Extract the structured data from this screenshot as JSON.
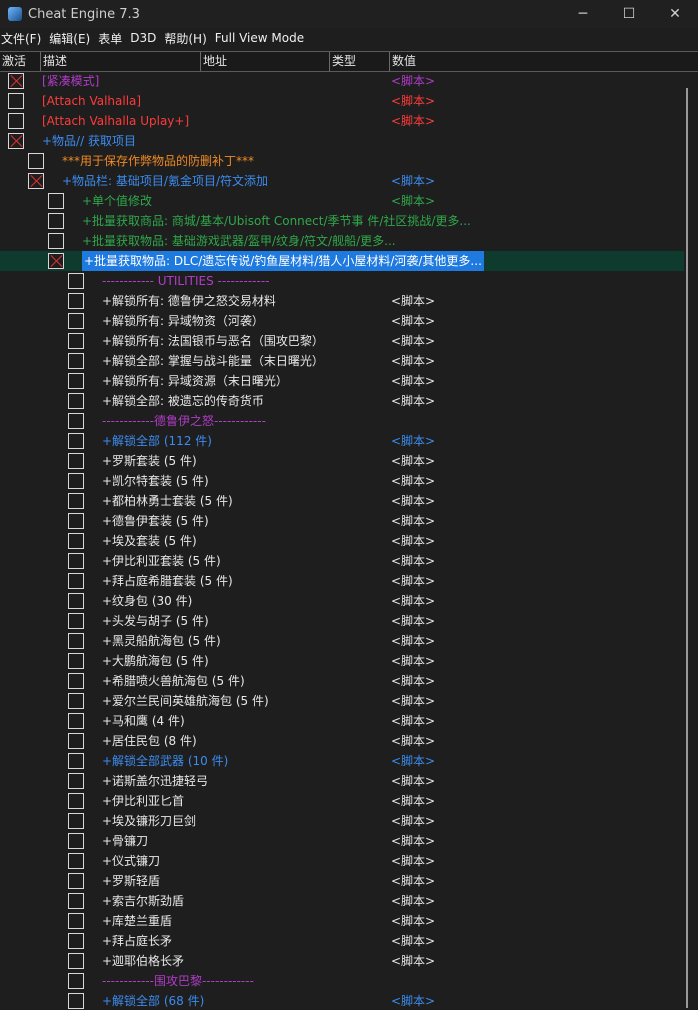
{
  "window": {
    "title": "Cheat Engine 7.3",
    "controls": {
      "minimize": "─",
      "maximize": "☐",
      "close": "✕"
    }
  },
  "menu": [
    "文件(F)",
    "编辑(E)",
    "表单",
    "D3D",
    "帮助(H)",
    "Full View Mode"
  ],
  "columns": [
    "激活",
    "描述",
    "地址",
    "类型",
    "数值"
  ],
  "colors": {
    "red": "#ff3b3b",
    "purple": "#b03cc8",
    "blue": "#3c8cf0",
    "orange": "#f08a24",
    "green": "#2fa84b",
    "white": "#e8e8e8",
    "script_white": "#e8e8e8"
  },
  "rows": [
    {
      "level": 0,
      "checked": true,
      "desc": "[紧凑模式]",
      "value": "<脚本>",
      "color": "#b03cc8",
      "vcolor": "#b03cc8"
    },
    {
      "level": 0,
      "checked": false,
      "desc": "[Attach Valhalla]",
      "value": "<脚本>",
      "color": "#ff3b3b",
      "vcolor": "#ff3b3b"
    },
    {
      "level": 0,
      "checked": false,
      "desc": "[Attach Valhalla Uplay+]",
      "value": "<脚本>",
      "color": "#ff3b3b",
      "vcolor": "#ff3b3b"
    },
    {
      "level": 0,
      "checked": true,
      "desc": "+物品// 获取项目",
      "value": "",
      "color": "#3c8cf0",
      "vcolor": "#3c8cf0"
    },
    {
      "level": 1,
      "checked": false,
      "desc": "***用于保存作弊物品的防删补丁***",
      "value": "",
      "color": "#f08a24",
      "vcolor": "#f08a24"
    },
    {
      "level": 1,
      "checked": true,
      "desc": "+物品栏: 基础项目/氪金项目/符文添加",
      "value": "<脚本>",
      "color": "#3c8cf0",
      "vcolor": "#3c8cf0"
    },
    {
      "level": 2,
      "checked": false,
      "desc": "+单个值修改",
      "value": "<脚本>",
      "color": "#2fa84b",
      "vcolor": "#2fa84b"
    },
    {
      "level": 2,
      "checked": false,
      "desc": "+批量获取商品: 商城/基本/Ubisoft Connect/季节事 件/社区挑战/更多...",
      "value": "",
      "color": "#2fa84b",
      "vcolor": "#2fa84b"
    },
    {
      "level": 2,
      "checked": false,
      "desc": "+批量获取物品: 基础游戏武器/盔甲/纹身/符文/舰船/更多...",
      "value": "",
      "color": "#2fa84b",
      "vcolor": "#2fa84b"
    },
    {
      "level": 2,
      "checked": true,
      "desc": "+批量获取物品: DLC/遗忘传说/钓鱼屋材料/猎人小屋材料/河袭/其他更多...",
      "value": "",
      "color": "#ffffff",
      "vcolor": "#ffffff",
      "selected": true
    },
    {
      "level": 3,
      "checked": false,
      "desc": "------------ UTILITIES ------------",
      "value": "",
      "color": "#b03cc8",
      "vcolor": "#b03cc8"
    },
    {
      "level": 3,
      "checked": false,
      "desc": "+解锁所有: 德鲁伊之怒交易材料",
      "value": "<脚本>",
      "color": "#e8e8e8",
      "vcolor": "#e8e8e8"
    },
    {
      "level": 3,
      "checked": false,
      "desc": "+解锁所有: 异域物资（河袭）",
      "value": "<脚本>",
      "color": "#e8e8e8",
      "vcolor": "#e8e8e8"
    },
    {
      "level": 3,
      "checked": false,
      "desc": "+解锁所有: 法国银币与恶名（围攻巴黎）",
      "value": "<脚本>",
      "color": "#e8e8e8",
      "vcolor": "#e8e8e8"
    },
    {
      "level": 3,
      "checked": false,
      "desc": "+解锁全部: 掌握与战斗能量（末日曙光）",
      "value": "<脚本>",
      "color": "#e8e8e8",
      "vcolor": "#e8e8e8"
    },
    {
      "level": 3,
      "checked": false,
      "desc": "+解锁所有: 异域资源（末日曙光）",
      "value": "<脚本>",
      "color": "#e8e8e8",
      "vcolor": "#e8e8e8"
    },
    {
      "level": 3,
      "checked": false,
      "desc": "+解锁全部: 被遗忘的传奇货币",
      "value": "<脚本>",
      "color": "#e8e8e8",
      "vcolor": "#e8e8e8"
    },
    {
      "level": 3,
      "checked": false,
      "desc": "------------德鲁伊之怒------------",
      "value": "",
      "color": "#b03cc8",
      "vcolor": "#b03cc8"
    },
    {
      "level": 3,
      "checked": false,
      "desc": "+解锁全部 (112 件)",
      "value": "<脚本>",
      "color": "#3c8cf0",
      "vcolor": "#3c8cf0"
    },
    {
      "level": 3,
      "checked": false,
      "desc": "+罗斯套装 (5 件)",
      "value": "<脚本>",
      "color": "#e8e8e8",
      "vcolor": "#e8e8e8"
    },
    {
      "level": 3,
      "checked": false,
      "desc": "+凯尔特套装 (5 件)",
      "value": "<脚本>",
      "color": "#e8e8e8",
      "vcolor": "#e8e8e8"
    },
    {
      "level": 3,
      "checked": false,
      "desc": "+都柏林勇士套装 (5 件)",
      "value": "<脚本>",
      "color": "#e8e8e8",
      "vcolor": "#e8e8e8"
    },
    {
      "level": 3,
      "checked": false,
      "desc": "+德鲁伊套装 (5 件)",
      "value": "<脚本>",
      "color": "#e8e8e8",
      "vcolor": "#e8e8e8"
    },
    {
      "level": 3,
      "checked": false,
      "desc": "+埃及套装 (5 件)",
      "value": "<脚本>",
      "color": "#e8e8e8",
      "vcolor": "#e8e8e8"
    },
    {
      "level": 3,
      "checked": false,
      "desc": "+伊比利亚套装 (5 件)",
      "value": "<脚本>",
      "color": "#e8e8e8",
      "vcolor": "#e8e8e8"
    },
    {
      "level": 3,
      "checked": false,
      "desc": "+拜占庭希腊套装 (5 件)",
      "value": "<脚本>",
      "color": "#e8e8e8",
      "vcolor": "#e8e8e8"
    },
    {
      "level": 3,
      "checked": false,
      "desc": "+纹身包 (30 件)",
      "value": "<脚本>",
      "color": "#e8e8e8",
      "vcolor": "#e8e8e8"
    },
    {
      "level": 3,
      "checked": false,
      "desc": "+头发与胡子 (5 件)",
      "value": "<脚本>",
      "color": "#e8e8e8",
      "vcolor": "#e8e8e8"
    },
    {
      "level": 3,
      "checked": false,
      "desc": "+黑灵船航海包 (5 件)",
      "value": "<脚本>",
      "color": "#e8e8e8",
      "vcolor": "#e8e8e8"
    },
    {
      "level": 3,
      "checked": false,
      "desc": "+大鹏航海包 (5 件)",
      "value": "<脚本>",
      "color": "#e8e8e8",
      "vcolor": "#e8e8e8"
    },
    {
      "level": 3,
      "checked": false,
      "desc": "+希腊喷火兽航海包 (5 件)",
      "value": "<脚本>",
      "color": "#e8e8e8",
      "vcolor": "#e8e8e8"
    },
    {
      "level": 3,
      "checked": false,
      "desc": "+爱尔兰民间英雄航海包 (5 件)",
      "value": "<脚本>",
      "color": "#e8e8e8",
      "vcolor": "#e8e8e8"
    },
    {
      "level": 3,
      "checked": false,
      "desc": "+马和鹰 (4 件)",
      "value": "<脚本>",
      "color": "#e8e8e8",
      "vcolor": "#e8e8e8"
    },
    {
      "level": 3,
      "checked": false,
      "desc": "+居住民包 (8 件)",
      "value": "<脚本>",
      "color": "#e8e8e8",
      "vcolor": "#e8e8e8"
    },
    {
      "level": 3,
      "checked": false,
      "desc": "+解锁全部武器 (10 件)",
      "value": "<脚本>",
      "color": "#3c8cf0",
      "vcolor": "#3c8cf0"
    },
    {
      "level": 3,
      "checked": false,
      "desc": "+诺斯盖尔迅捷轻弓",
      "value": "<脚本>",
      "color": "#e8e8e8",
      "vcolor": "#e8e8e8"
    },
    {
      "level": 3,
      "checked": false,
      "desc": "+伊比利亚匕首",
      "value": "<脚本>",
      "color": "#e8e8e8",
      "vcolor": "#e8e8e8"
    },
    {
      "level": 3,
      "checked": false,
      "desc": "+埃及镰形刀巨剑",
      "value": "<脚本>",
      "color": "#e8e8e8",
      "vcolor": "#e8e8e8"
    },
    {
      "level": 3,
      "checked": false,
      "desc": "+骨镰刀",
      "value": "<脚本>",
      "color": "#e8e8e8",
      "vcolor": "#e8e8e8"
    },
    {
      "level": 3,
      "checked": false,
      "desc": "+仪式镰刀",
      "value": "<脚本>",
      "color": "#e8e8e8",
      "vcolor": "#e8e8e8"
    },
    {
      "level": 3,
      "checked": false,
      "desc": "+罗斯轻盾",
      "value": "<脚本>",
      "color": "#e8e8e8",
      "vcolor": "#e8e8e8"
    },
    {
      "level": 3,
      "checked": false,
      "desc": "+索吉尔斯劲盾",
      "value": "<脚本>",
      "color": "#e8e8e8",
      "vcolor": "#e8e8e8"
    },
    {
      "level": 3,
      "checked": false,
      "desc": "+库楚兰重盾",
      "value": "<脚本>",
      "color": "#e8e8e8",
      "vcolor": "#e8e8e8"
    },
    {
      "level": 3,
      "checked": false,
      "desc": "+拜占庭长矛",
      "value": "<脚本>",
      "color": "#e8e8e8",
      "vcolor": "#e8e8e8"
    },
    {
      "level": 3,
      "checked": false,
      "desc": "+迦耶伯格长矛",
      "value": "<脚本>",
      "color": "#e8e8e8",
      "vcolor": "#e8e8e8"
    },
    {
      "level": 3,
      "checked": false,
      "desc": "------------围攻巴黎------------",
      "value": "",
      "color": "#b03cc8",
      "vcolor": "#b03cc8"
    },
    {
      "level": 3,
      "checked": false,
      "desc": "+解锁全部 (68 件)",
      "value": "<脚本>",
      "color": "#3c8cf0",
      "vcolor": "#3c8cf0"
    }
  ]
}
